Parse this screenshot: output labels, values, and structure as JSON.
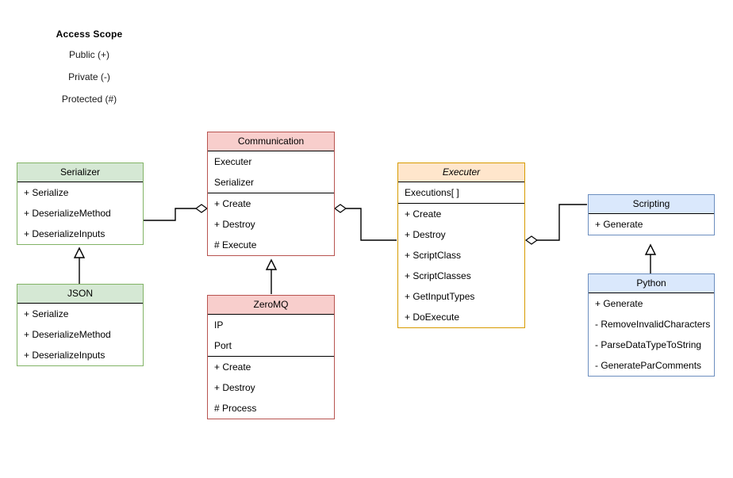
{
  "diagram": {
    "type": "uml-class-diagram",
    "background": "#ffffff"
  },
  "legend": {
    "title": "Access Scope",
    "items": [
      {
        "label": "Public (+)"
      },
      {
        "label": "Private (-)"
      },
      {
        "label": "Protected (#)"
      }
    ]
  },
  "classes": [
    {
      "id": "serializer",
      "name": "Serializer",
      "abstract": false,
      "color": "green",
      "fill": "#d5e8d4",
      "stroke": "#82b366",
      "attributes": [],
      "methods": [
        "+ Serialize",
        "+ DeserializeMethod",
        "+ DeserializeInputs"
      ]
    },
    {
      "id": "json",
      "name": "JSON",
      "abstract": false,
      "color": "green",
      "fill": "#d5e8d4",
      "stroke": "#82b366",
      "attributes": [],
      "methods": [
        "+ Serialize",
        "+ DeserializeMethod",
        "+ DeserializeInputs"
      ]
    },
    {
      "id": "communication",
      "name": "Communication",
      "abstract": false,
      "color": "red",
      "fill": "#f8cecc",
      "stroke": "#b85450",
      "attributes": [
        "Executer",
        "Serializer"
      ],
      "methods": [
        "+ Create",
        "+ Destroy",
        "# Execute"
      ]
    },
    {
      "id": "zeromq",
      "name": "ZeroMQ",
      "abstract": false,
      "color": "red",
      "fill": "#f8cecc",
      "stroke": "#b85450",
      "attributes": [
        "IP",
        "Port"
      ],
      "methods": [
        "+ Create",
        "+ Destroy",
        "# Process"
      ]
    },
    {
      "id": "executer",
      "name": "Executer",
      "abstract": true,
      "color": "orange",
      "fill": "#ffe6cc",
      "stroke": "#d79b00",
      "attributes": [
        "Executions[ ]"
      ],
      "methods": [
        "+ Create",
        "+ Destroy",
        "+ ScriptClass",
        "+ ScriptClasses",
        "+ GetInputTypes",
        "+ DoExecute"
      ]
    },
    {
      "id": "scripting",
      "name": "Scripting",
      "abstract": false,
      "color": "blue",
      "fill": "#dae8fc",
      "stroke": "#6c8ebf",
      "attributes": [],
      "methods": [
        "+ Generate"
      ]
    },
    {
      "id": "python",
      "name": "Python",
      "abstract": false,
      "color": "blue",
      "fill": "#dae8fc",
      "stroke": "#6c8ebf",
      "attributes": [],
      "methods": [
        "+ Generate",
        "- RemoveInvalidCharacters",
        "- ParseDataTypeToString",
        "- GenerateParComments"
      ]
    }
  ],
  "relationships": [
    {
      "id": "json-serializer",
      "type": "generalization",
      "from": "json",
      "to": "serializer"
    },
    {
      "id": "zeromq-communication",
      "type": "generalization",
      "from": "zeromq",
      "to": "communication"
    },
    {
      "id": "python-scripting",
      "type": "generalization",
      "from": "python",
      "to": "scripting"
    },
    {
      "id": "communication-serializer",
      "type": "aggregation",
      "from": "communication",
      "to": "serializer"
    },
    {
      "id": "communication-executer",
      "type": "aggregation",
      "from": "communication",
      "to": "executer"
    },
    {
      "id": "executer-scripting",
      "type": "aggregation",
      "from": "executer",
      "to": "scripting"
    }
  ]
}
